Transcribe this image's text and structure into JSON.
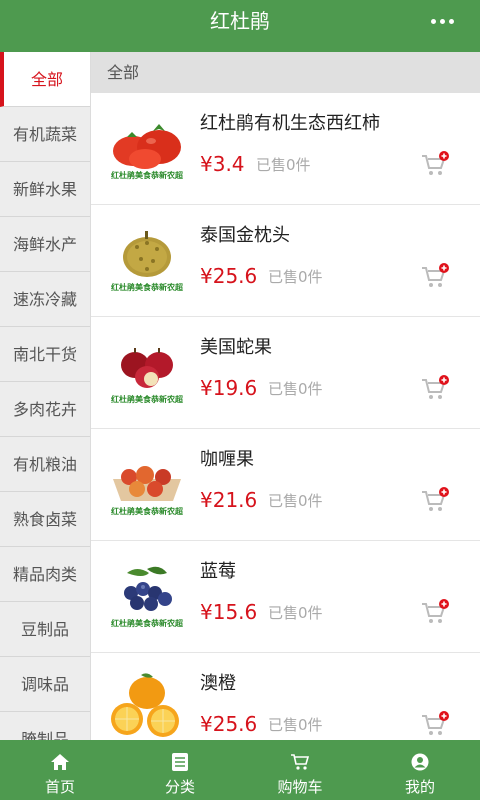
{
  "header": {
    "title": "红杜鹃",
    "more_icon": "more-dots-icon"
  },
  "sidebar": {
    "items": [
      {
        "label": "全部"
      },
      {
        "label": "有机蔬菜"
      },
      {
        "label": "新鲜水果"
      },
      {
        "label": "海鲜水产"
      },
      {
        "label": "速冻冷藏"
      },
      {
        "label": "南北干货"
      },
      {
        "label": "多肉花卉"
      },
      {
        "label": "有机粮油"
      },
      {
        "label": "熟食卤菜"
      },
      {
        "label": "精品肉类"
      },
      {
        "label": "豆制品"
      },
      {
        "label": "调味品"
      },
      {
        "label": "腌制品"
      }
    ],
    "active_index": 0
  },
  "content": {
    "header": "全部",
    "products": [
      {
        "name": "红杜鹃有机生态西红柿",
        "price": "¥3.4",
        "sold": "已售0件",
        "image": "tomato",
        "caption": "红杜鹃美食恭新农超"
      },
      {
        "name": "泰国金枕头",
        "price": "¥25.6",
        "sold": "已售0件",
        "image": "durian",
        "caption": "红杜鹃美食恭新农超"
      },
      {
        "name": "美国蛇果",
        "price": "¥19.6",
        "sold": "已售0件",
        "image": "apple",
        "caption": "红杜鹃美食恭新农超"
      },
      {
        "name": "咖喱果",
        "price": "¥21.6",
        "sold": "已售0件",
        "image": "fruit-basket",
        "caption": "红杜鹃美食恭新农超"
      },
      {
        "name": "蓝莓",
        "price": "¥15.6",
        "sold": "已售0件",
        "image": "blueberry",
        "caption": "红杜鹃美食恭新农超"
      },
      {
        "name": "澳橙",
        "price": "¥25.6",
        "sold": "已售0件",
        "image": "orange",
        "caption": ""
      }
    ]
  },
  "tabbar": {
    "items": [
      {
        "label": "首页",
        "icon": "home-icon"
      },
      {
        "label": "分类",
        "icon": "list-icon"
      },
      {
        "label": "购物车",
        "icon": "cart-icon"
      },
      {
        "label": "我的",
        "icon": "user-icon"
      }
    ]
  },
  "colors": {
    "brand_green": "#4e9a4f",
    "price_red": "#d6131c",
    "active_red": "#d6131c"
  }
}
